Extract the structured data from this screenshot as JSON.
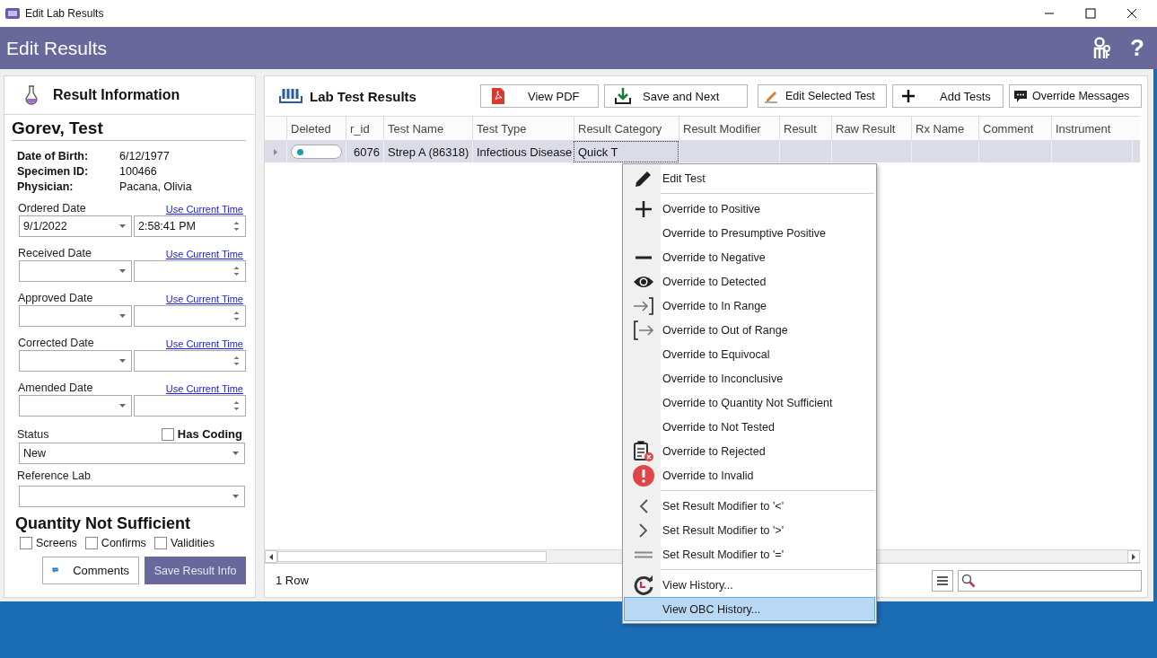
{
  "window": {
    "title": "Edit Lab Results"
  },
  "header": {
    "title": "Edit Results",
    "help": "?"
  },
  "result_info": {
    "title": "Result Information",
    "patient": "Gorev, Test",
    "details": [
      {
        "label": "Date of Birth:",
        "value": "6/12/1977"
      },
      {
        "label": "Specimen ID:",
        "value": "100466"
      },
      {
        "label": "Physician:",
        "value": "Pacana, Olivia"
      }
    ],
    "dates": [
      {
        "label": "Ordered Date",
        "link": "Use Current Time",
        "date": "9/1/2022",
        "time": "2:58:41 PM"
      },
      {
        "label": "Received Date",
        "link": "Use Current Time"
      },
      {
        "label": "Approved Date",
        "link": "Use Current Time"
      },
      {
        "label": "Corrected Date",
        "link": "Use Current Time"
      },
      {
        "label": "Amended Date",
        "link": "Use Current Time"
      }
    ],
    "status": {
      "label": "Status",
      "value": "New"
    },
    "has_coding": {
      "label": "Has Coding",
      "checked": false
    },
    "reference_lab": {
      "label": "Reference Lab"
    },
    "qns": {
      "title": "Quantity Not Sufficient",
      "options": [
        {
          "label": "Screens",
          "checked": false
        },
        {
          "label": "Confirms",
          "checked": false
        },
        {
          "label": "Validities",
          "checked": false
        }
      ]
    },
    "buttons": {
      "comments": "Comments",
      "save": "Save Result Info"
    }
  },
  "lab_results": {
    "title": "Lab Test Results",
    "toolbar_left": [
      "View PDF",
      "Save and Next"
    ],
    "toolbar_right": [
      "Edit Selected Test",
      "Add Tests",
      "Override Messages"
    ],
    "table": {
      "columns": [
        "Deleted",
        "r_id",
        "Test Name",
        "Test Type",
        "Result Category",
        "Result Modifier",
        "Result",
        "Raw Result",
        "Rx Name",
        "Comment",
        "Instrument"
      ],
      "rows": [
        {
          "selected": true,
          "deleted": false,
          "r_id": "6076",
          "test_name": "Strep A (86318)",
          "test_type": "Infectious Disease",
          "result_category": "Quick T"
        }
      ]
    },
    "row_count": "1 Row"
  },
  "context_menu": {
    "groups": [
      [
        {
          "label": "Edit Test",
          "selected": false
        }
      ],
      [
        {
          "label": "Override to Positive",
          "selected": false
        },
        {
          "label": "Override to Presumptive Positive",
          "selected": false
        },
        {
          "label": "Override to Negative",
          "selected": false
        },
        {
          "label": "Override to Detected",
          "selected": false
        },
        {
          "label": "Override to In Range",
          "selected": false
        },
        {
          "label": "Override to Out of Range",
          "selected": false
        },
        {
          "label": "Override to Equivocal",
          "selected": false
        },
        {
          "label": "Override to Inconclusive",
          "selected": false
        },
        {
          "label": "Override to Quantity Not Sufficient",
          "selected": false
        },
        {
          "label": "Override to Not Tested",
          "selected": false
        },
        {
          "label": "Override to Rejected",
          "selected": false
        },
        {
          "label": "Override to Invalid",
          "selected": false
        }
      ],
      [
        {
          "label": "Set Result Modifier to '<'",
          "selected": false
        },
        {
          "label": "Set Result Modifier to '>'",
          "selected": false
        },
        {
          "label": "Set Result Modifier to '='",
          "selected": false
        }
      ],
      [
        {
          "label": "View History...",
          "selected": false
        },
        {
          "label": "View OBC History...",
          "selected": true
        }
      ]
    ]
  }
}
